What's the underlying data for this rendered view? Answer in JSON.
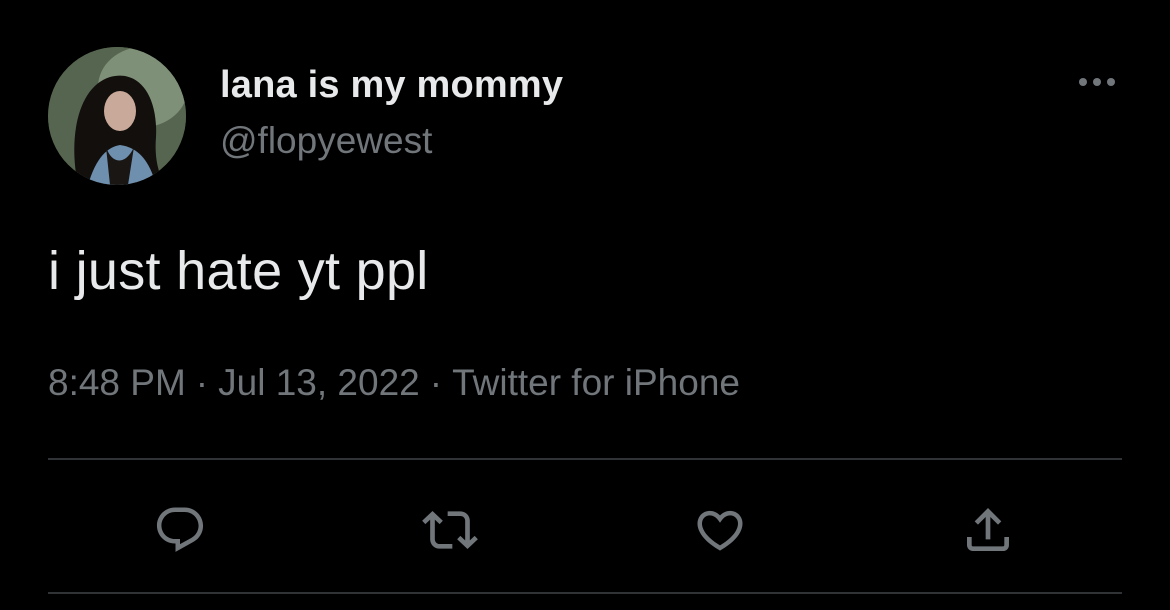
{
  "tweet": {
    "author": {
      "display_name": "lana is my mommy",
      "handle": "@flopyewest",
      "avatar_icon": "profile-photo"
    },
    "text": "i just hate yt ppl",
    "meta": {
      "time": "8:48 PM",
      "separator": "·",
      "date": "Jul 13, 2022",
      "source": "Twitter for iPhone"
    },
    "actions": [
      {
        "name": "reply",
        "icon": "speech-bubble-icon"
      },
      {
        "name": "retweet",
        "icon": "retweet-icon"
      },
      {
        "name": "like",
        "icon": "heart-icon"
      },
      {
        "name": "share",
        "icon": "share-upload-icon"
      }
    ],
    "more_icon": "ellipsis-icon"
  },
  "colors": {
    "background": "#000000",
    "primary_text": "#e7e9ea",
    "secondary_text": "#71767b",
    "divider": "#2f3336"
  }
}
